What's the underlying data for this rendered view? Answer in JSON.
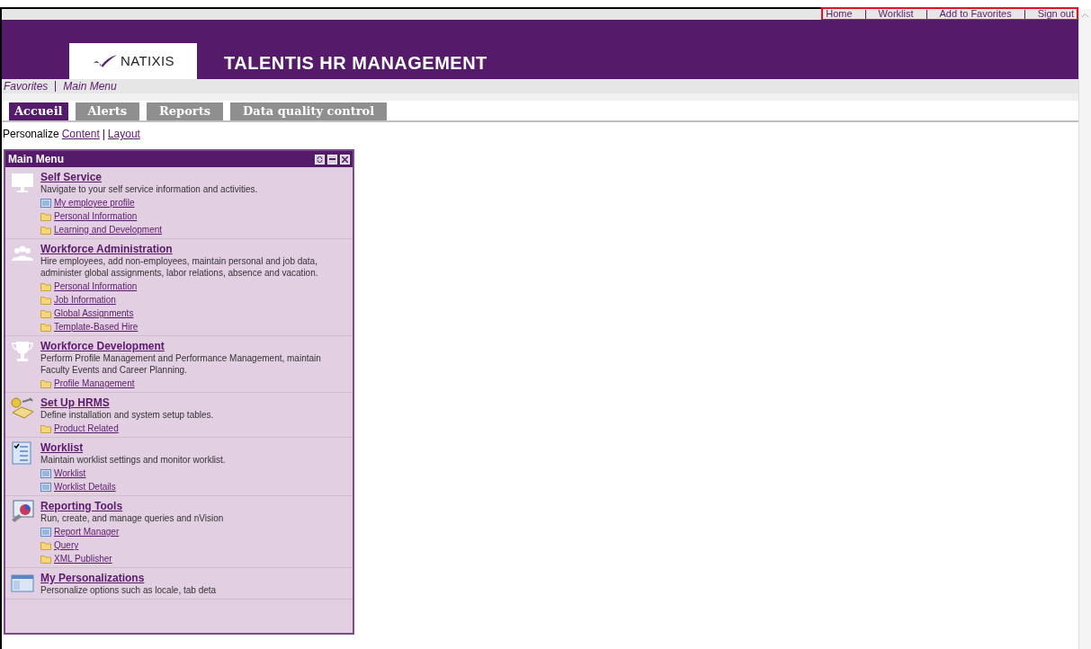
{
  "top_links": {
    "highlighted": true,
    "items": [
      "Home",
      "Worklist",
      "Add to Favorites",
      "Sign out"
    ]
  },
  "header": {
    "logo": "NATIXIS",
    "title": "TALENTIS HR MANAGEMENT"
  },
  "nav": [
    "Favorites",
    "Main Menu"
  ],
  "tabs": [
    {
      "label": "Accueil",
      "selected": true
    },
    {
      "label": "Alerts",
      "selected": false
    },
    {
      "label": "Reports",
      "selected": false
    },
    {
      "label": "Data quality control",
      "selected": false
    }
  ],
  "personalize": {
    "label": "Personalize",
    "links": [
      "Content",
      "Layout"
    ],
    "separator": "|"
  },
  "panel": {
    "title": "Main Menu",
    "sections": [
      {
        "title": "Self Service",
        "description": "Navigate to your self service information and activities.",
        "links": [
          {
            "kind": "page",
            "label": "My employee profile"
          },
          {
            "kind": "folder",
            "label": "Personal Information"
          },
          {
            "kind": "folder",
            "label": "Learning and Development"
          }
        ]
      },
      {
        "title": "Workforce Administration",
        "description": "Hire employees, add non-employees, maintain personal and job data, administer global assignments, labor relations, absence and vacation.",
        "links": [
          {
            "kind": "folder",
            "label": "Personal Information"
          },
          {
            "kind": "folder",
            "label": "Job Information"
          },
          {
            "kind": "folder",
            "label": "Global Assignments"
          },
          {
            "kind": "folder",
            "label": "Template-Based Hire"
          }
        ]
      },
      {
        "title": "Workforce Development",
        "description": "Perform Profile Management and Performance Management, maintain Faculty Events and Career Planning.",
        "links": [
          {
            "kind": "folder",
            "label": "Profile Management"
          }
        ]
      },
      {
        "title": "Set Up HRMS",
        "description": "Define installation and system setup tables.",
        "links": [
          {
            "kind": "folder",
            "label": "Product Related"
          }
        ]
      },
      {
        "title": "Worklist",
        "description": "Maintain worklist settings and monitor worklist.",
        "links": [
          {
            "kind": "page",
            "label": "Worklist"
          },
          {
            "kind": "page",
            "label": "Worklist Details"
          }
        ]
      },
      {
        "title": "Reporting Tools",
        "description": "Run, create, and manage queries and nVision",
        "links": [
          {
            "kind": "page",
            "label": "Report Manager"
          },
          {
            "kind": "folder",
            "label": "Query"
          },
          {
            "kind": "folder",
            "label": "XML Publisher"
          }
        ]
      },
      {
        "title": "My Personalizations",
        "description": "Personalize options such as locale, tab deta"
      }
    ]
  }
}
